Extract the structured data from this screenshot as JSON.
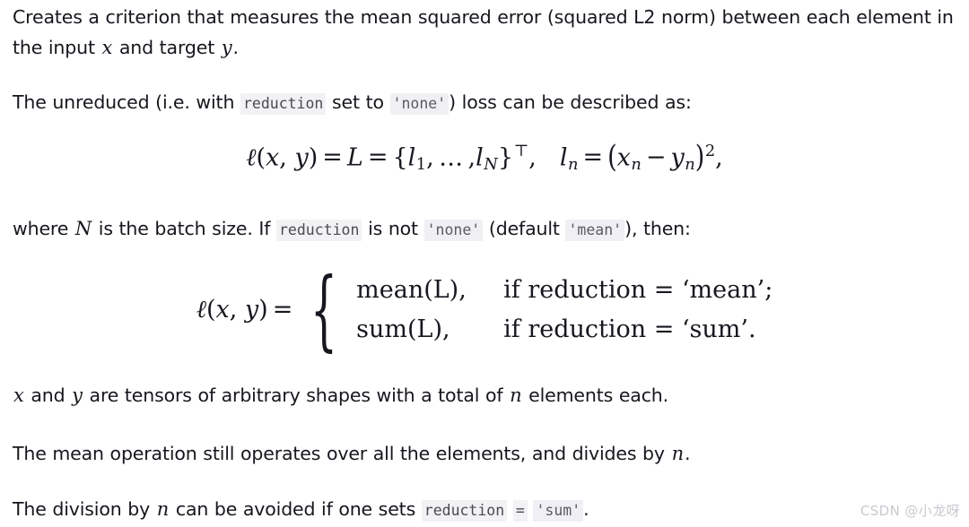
{
  "document": {
    "paragraphs": {
      "p1": {
        "seg1": "Creates a criterion that measures the mean squared error (squared L2 norm) between each element in the input ",
        "math_x": "x",
        "seg2": " and target ",
        "math_y": "y",
        "seg3": "."
      },
      "p2": {
        "seg1": "The unreduced (i.e. with ",
        "code_reduction": "reduction",
        "seg2": " set to ",
        "code_none": "'none'",
        "seg3": ") loss can be described as:"
      },
      "p3": {
        "seg1": "where ",
        "math_N": "N",
        "seg2": " is the batch size. If ",
        "code_reduction": "reduction",
        "seg3": " is not ",
        "code_none": "'none'",
        "seg4": " (default ",
        "code_mean": "'mean'",
        "seg5": "), then:"
      },
      "p4": {
        "math_x": "x",
        "seg1": " and ",
        "math_y": "y",
        "seg2": " are tensors of arbitrary shapes with a total of ",
        "math_n": "n",
        "seg3": " elements each."
      },
      "p5": {
        "seg1": "The mean operation still operates over all the elements, and divides by ",
        "math_n": "n",
        "seg2": "."
      },
      "p6": {
        "seg1": "The division by ",
        "math_n": "n",
        "seg2": " can be avoided if one sets ",
        "code_reduction": "reduction",
        "code_equals": "=",
        "code_sum": "'sum'",
        "seg3": "."
      }
    },
    "equation1": {
      "lhs_ell": "ℓ",
      "lhs_open": "(",
      "lhs_x": "x",
      "lhs_comma": ",",
      "lhs_y": "y",
      "lhs_close": ")",
      "eq1": "=",
      "L": "L",
      "eq2": "=",
      "brace_open": "{",
      "l1": "l",
      "l1_sub": "1",
      "ellipsis": ", … ,",
      "lN": "l",
      "lN_sub": "N",
      "brace_close": "}",
      "transpose": "⊤",
      "comma": ",",
      "ln": "l",
      "ln_sub": "n",
      "eq3": "=",
      "open": "(",
      "xn": "x",
      "xn_sub": "n",
      "minus": "−",
      "yn": "y",
      "yn_sub": "n",
      "close": ")",
      "power": "2",
      "trailing_comma": ","
    },
    "equation2": {
      "lhs_ell": "ℓ",
      "lhs_open": "(",
      "lhs_x": "x",
      "lhs_comma": ",",
      "lhs_y": "y",
      "lhs_close": ")",
      "eq": "=",
      "brace": "{",
      "case1_value": "mean(L),",
      "case1_cond": "if reduction = ‘mean’;",
      "case2_value": "sum(L),",
      "case2_cond": "if reduction = ‘sum’."
    },
    "watermark": "CSDN @小龙呀"
  }
}
